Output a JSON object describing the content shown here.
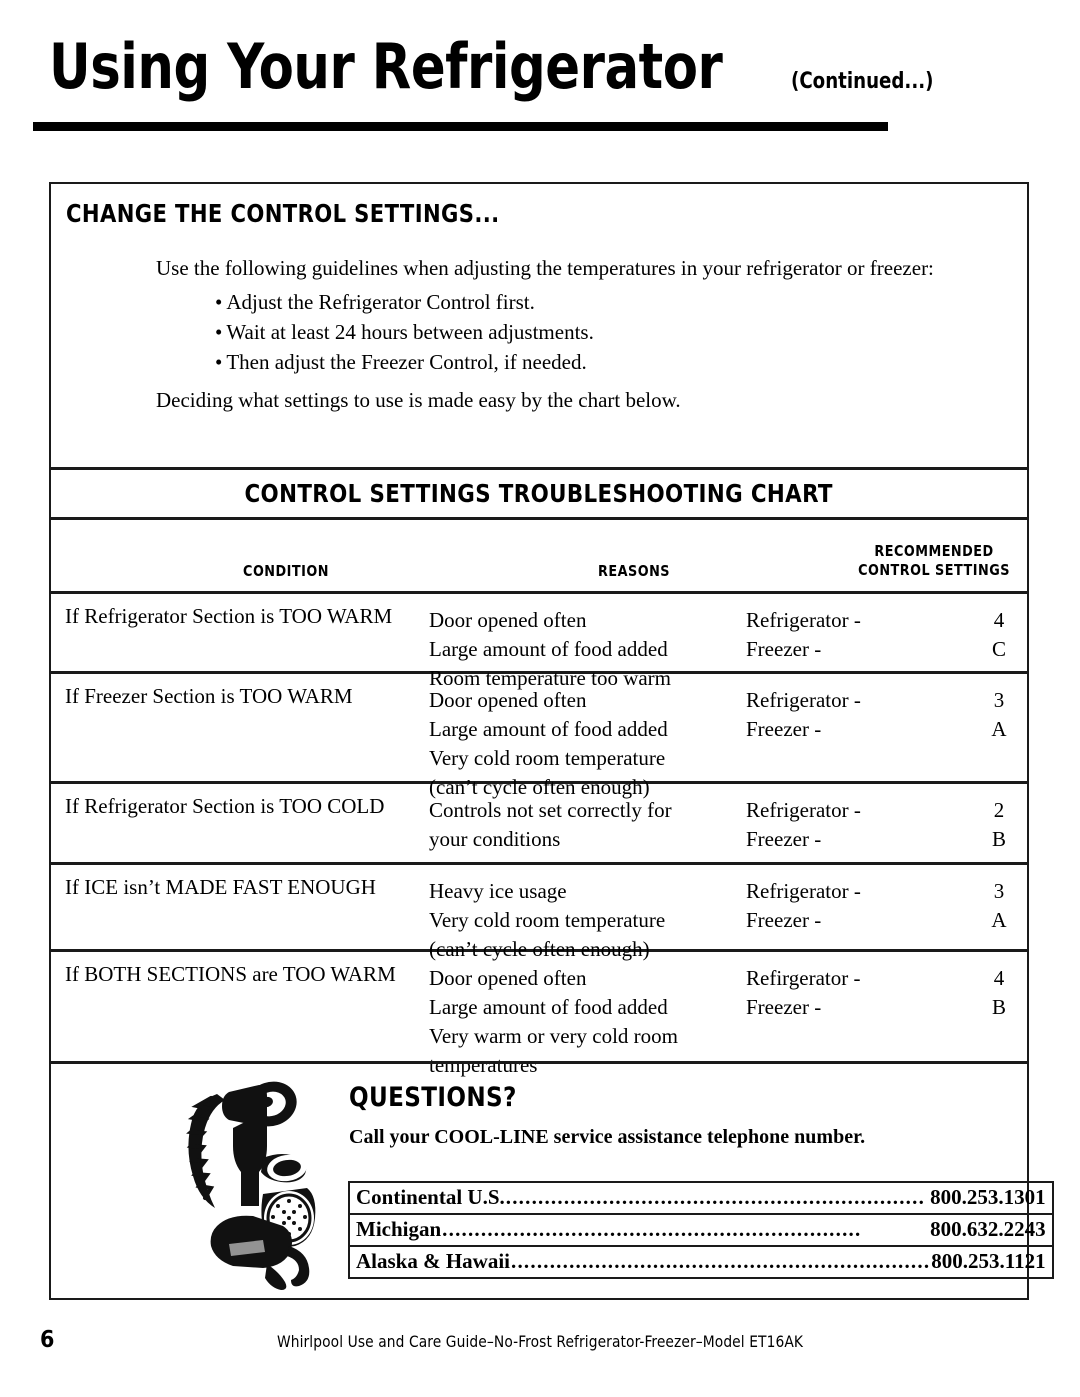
{
  "page": {
    "title_main": "Using Your Refrigerator",
    "title_continued": "(Continued...)",
    "footer_page_number": "6",
    "footer_text": "Whirlpool Use and Care Guide–No-Frost Refrigerator-Freezer–Model ET16AK"
  },
  "change_settings": {
    "heading": "CHANGE THE CONTROL SETTINGS...",
    "intro": "Use the following guidelines when adjusting the temperatures in your refrigerator or freezer:",
    "guidelines": [
      "Adjust the Refrigerator Control first.",
      "Wait at least 24 hours between adjustments.",
      "Then adjust the Freezer Control, if needed."
    ],
    "bullet_glyph": "•",
    "closing": "Deciding what settings to use is made easy by the chart below."
  },
  "chart": {
    "title": "CONTROL SETTINGS TROUBLESHOOTING CHART",
    "headers": {
      "condition": "CONDITION",
      "reasons": "REASONS",
      "settings_line1": "RECOMMENDED",
      "settings_line2": "CONTROL SETTINGS"
    },
    "rows": [
      {
        "condition": "If Refrigerator Section is TOO WARM",
        "reasons": [
          "Door opened often",
          "Large amount of food added",
          "Room temperature too warm"
        ],
        "setting_labels": [
          "Refrigerator -",
          "Freezer -"
        ],
        "setting_values": [
          "4",
          "C"
        ]
      },
      {
        "condition": "If Freezer Section is TOO WARM",
        "reasons": [
          "Door opened often",
          "Large amount of food added",
          "Very cold room temperature",
          "(can’t cycle often enough)"
        ],
        "setting_labels": [
          "Refrigerator -",
          "Freezer -"
        ],
        "setting_values": [
          "3",
          "A"
        ]
      },
      {
        "condition": "If Refrigerator Section is TOO COLD",
        "reasons": [
          "Controls not set correctly for",
          "your conditions"
        ],
        "setting_labels": [
          "Refrigerator -",
          "Freezer -"
        ],
        "setting_values": [
          "2",
          "B"
        ]
      },
      {
        "condition": "If ICE isn’t MADE FAST ENOUGH",
        "reasons": [
          "Heavy ice usage",
          "Very cold room temperature",
          "(can’t cycle often enough)"
        ],
        "setting_labels": [
          "Refrigerator -",
          "Freezer -"
        ],
        "setting_values": [
          "3",
          "A"
        ]
      },
      {
        "condition": "If BOTH SECTIONS are TOO WARM",
        "reasons": [
          "Door opened often",
          "Large amount of food added",
          "Very warm or very cold room",
          "temperatures"
        ],
        "setting_labels": [
          "Refirgerator -",
          "Freezer -"
        ],
        "setting_values": [
          "4",
          "B"
        ]
      }
    ]
  },
  "questions": {
    "heading": "QUESTIONS?",
    "subtitle": "Call your COOL-LINE service assistance telephone number.",
    "illustration_name": "vintage-telephone-illustration",
    "phone_rows": [
      {
        "region": "Continental U.S.",
        "number": "800.253.1301"
      },
      {
        "region": "Michigan",
        "number": "800.632.2243"
      },
      {
        "region": "Alaska & Hawaii",
        "number": "800.253.1121"
      }
    ]
  },
  "colors": {
    "ink": "#000000",
    "rule": "#1a1a1a",
    "paper": "#ffffff"
  }
}
